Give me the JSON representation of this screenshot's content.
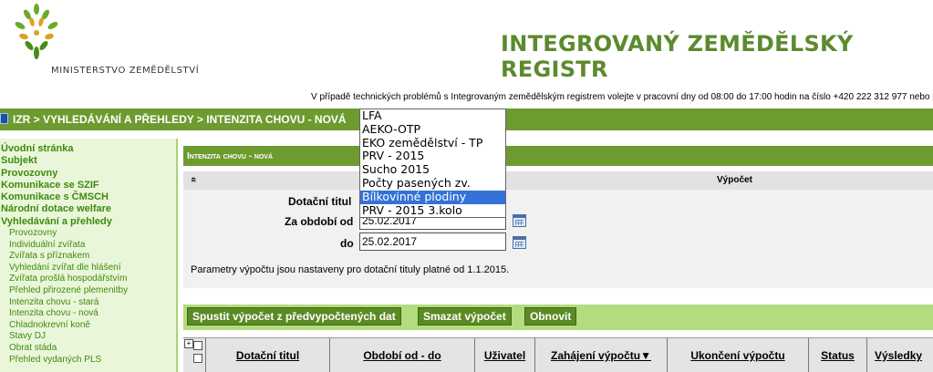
{
  "header": {
    "ministry": "MINISTERSTVO ZEMĚDĚLSTVÍ",
    "title": "INTEGROVANÝ ZEMĚDĚLSKÝ REGISTR",
    "notice": "V případě technických problémů s Integrovaným zemědělským registrem volejte v pracovní dny od 08:00 do 17:00 hodin na číslo +420 222 312 977 nebo pi"
  },
  "breadcrumb": "IZR > VYHLEDÁVÁNÍ A PŘEHLEDY > INTENZITA CHOVU - NOVÁ",
  "sidebar": {
    "main_items": [
      "Úvodní stránka",
      "Subjekt",
      "Provozovny",
      "Komunikace se SZIF",
      "Komunikace s ČMSCH",
      "Národní dotace welfare",
      "Vyhledávání a přehledy"
    ],
    "sub_items": [
      "Provozovny",
      "Individuální zvířata",
      "Zvířata s příznakem",
      "Vyhledání zvířat dle hlášení",
      "Zvířata prošlá hospodářstvím",
      "Přehled přirozené plemenitby",
      "Intenzita chovu - stará",
      "Intenzita chovu - nová",
      "Chladnokrevní koně",
      "Stavy DJ",
      "Obrat stáda",
      "Přehled vydaných PLS"
    ]
  },
  "section": {
    "title": "Intenzita chovu - nová",
    "panel_label": "Výpočet",
    "collapse": "«"
  },
  "form": {
    "dotacni_label": "Dotační titul",
    "od_label": "Za období od",
    "od_value": "25.02.2017",
    "do_label": "do",
    "do_value": "25.02.2017",
    "params_text": "Parametry výpočtu jsou nastaveny pro dotační tituly platné od 1.1.2015."
  },
  "buttons": {
    "run": "Spustit výpočet z předvypočtených dat",
    "delete": "Smazat výpočet",
    "refresh": "Obnovit"
  },
  "grid": {
    "columns": [
      "Dotační titul",
      "Období od - do",
      "Uživatel",
      "Zahájení výpočtu▼",
      "Ukončení výpočtu",
      "Status",
      "Výsledky"
    ]
  },
  "dropdown": {
    "options": [
      "LFA",
      "AEKO-OTP",
      "EKO zemědělství - TP",
      "PRV - 2015",
      "Sucho 2015",
      "Počty pasených zv.",
      "Bílkovinné plodiny",
      "PRV - 2015 3.kolo"
    ],
    "selected_index": 6
  },
  "colors": {
    "brand_green": "#5c8a2e",
    "bar_green": "#6d9b2f",
    "sidebar_bg": "#eaf6d9",
    "selection_blue": "#3572d8"
  }
}
